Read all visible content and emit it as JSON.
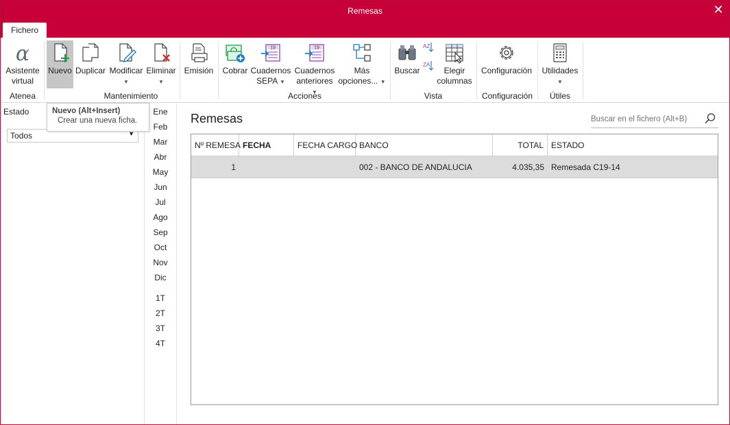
{
  "window": {
    "title": "Remesas",
    "close_label": "✕"
  },
  "tabs": [
    {
      "label": "Fichero"
    }
  ],
  "ribbon": {
    "buttons": {
      "asistente": "Asistente virtual",
      "nuevo": "Nuevo",
      "duplicar": "Duplicar",
      "modificar": "Modificar",
      "eliminar": "Eliminar",
      "emision": "Emisión",
      "cobrar": "Cobrar",
      "cuadernos_sepa": "Cuadernos SEPA",
      "cuadernos_anteriores": "Cuadernos anteriores",
      "mas_opciones": "Más opciones...",
      "buscar": "Buscar",
      "elegir_columnas": "Elegir columnas",
      "configuracion": "Configuración",
      "utilidades": "Utilidades"
    },
    "groups": {
      "atenea": "Atenea",
      "mantenimiento": "Mantenimiento",
      "acciones": "Acciones",
      "vista": "Vista",
      "configuracion": "Configuración",
      "utiles": "Útiles"
    },
    "badge_19": "19",
    "sort_labels": {
      "az": "AZ",
      "za": "ZA"
    }
  },
  "tooltip": {
    "title": "Nuevo (Alt+Insert)",
    "description": "Crear una nueva ficha."
  },
  "filter": {
    "estado_label": "Estado",
    "estado_value": "Todos"
  },
  "periods": {
    "months": [
      "Ene",
      "Feb",
      "Mar",
      "Abr",
      "May",
      "Jun",
      "Jul",
      "Ago",
      "Sep",
      "Oct",
      "Nov",
      "Dic"
    ],
    "quarters": [
      "1T",
      "2T",
      "3T",
      "4T"
    ]
  },
  "main": {
    "title": "Remesas",
    "search_placeholder": "Buscar en el fichero (Alt+B)",
    "columns": [
      "Nº REMESA",
      "FECHA",
      "FECHA CARGO",
      "BANCO",
      "TOTAL",
      "ESTADO"
    ],
    "rows": [
      {
        "numero": "1",
        "fecha": "",
        "fecha_cargo": "",
        "banco": "002 - BANCO DE ANDALUCIA",
        "total": "4.035,35",
        "estado": "Remesada C19-14"
      }
    ]
  },
  "colors": {
    "brand": "#c8003a",
    "selected_row": "#dcdcdc",
    "active_button": "#c6c6c6",
    "icon_green": "#1e9e4a",
    "icon_blue": "#1b7fc1",
    "icon_purple": "#8e44ad"
  }
}
